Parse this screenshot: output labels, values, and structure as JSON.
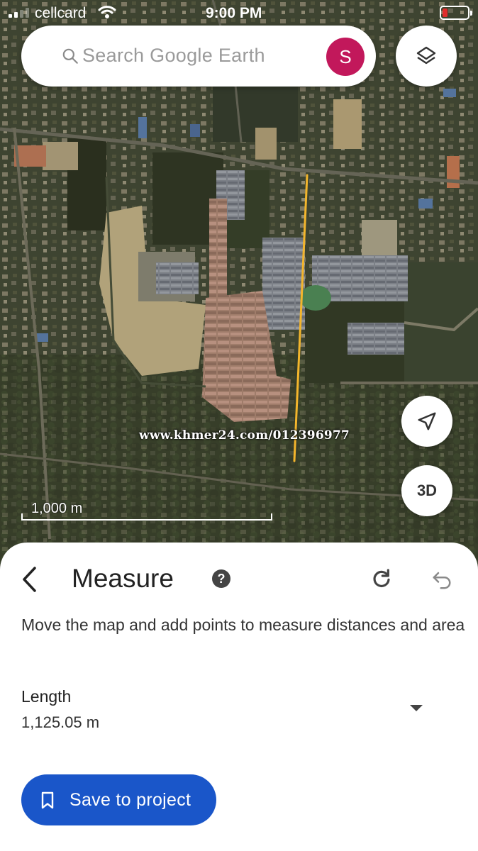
{
  "status_bar": {
    "carrier": "cellcard",
    "time": "9:00 PM"
  },
  "search": {
    "placeholder": "Search Google Earth",
    "avatar_letter": "S",
    "avatar_color": "#c2185b"
  },
  "map": {
    "watermark": "www.khmer24.com/012396977",
    "scale_label": "1,000 m",
    "measure_line_color": "#f3b52c",
    "three_d_label": "3D"
  },
  "icons": {
    "search": "search-icon",
    "layers": "layers-icon",
    "location": "navigation-arrow-icon",
    "back": "chevron-left-icon",
    "help": "help-circle-icon",
    "redo": "redo-icon",
    "undo": "undo-icon",
    "dropdown": "caret-down-icon",
    "bookmark": "bookmark-icon"
  },
  "panel": {
    "title": "Measure",
    "help_symbol": "?",
    "description": "Move the map and add points to measure distances and area",
    "length_label": "Length",
    "length_value": "1,125.05 m",
    "save_label": "Save to project",
    "save_color": "#1a56c9"
  }
}
